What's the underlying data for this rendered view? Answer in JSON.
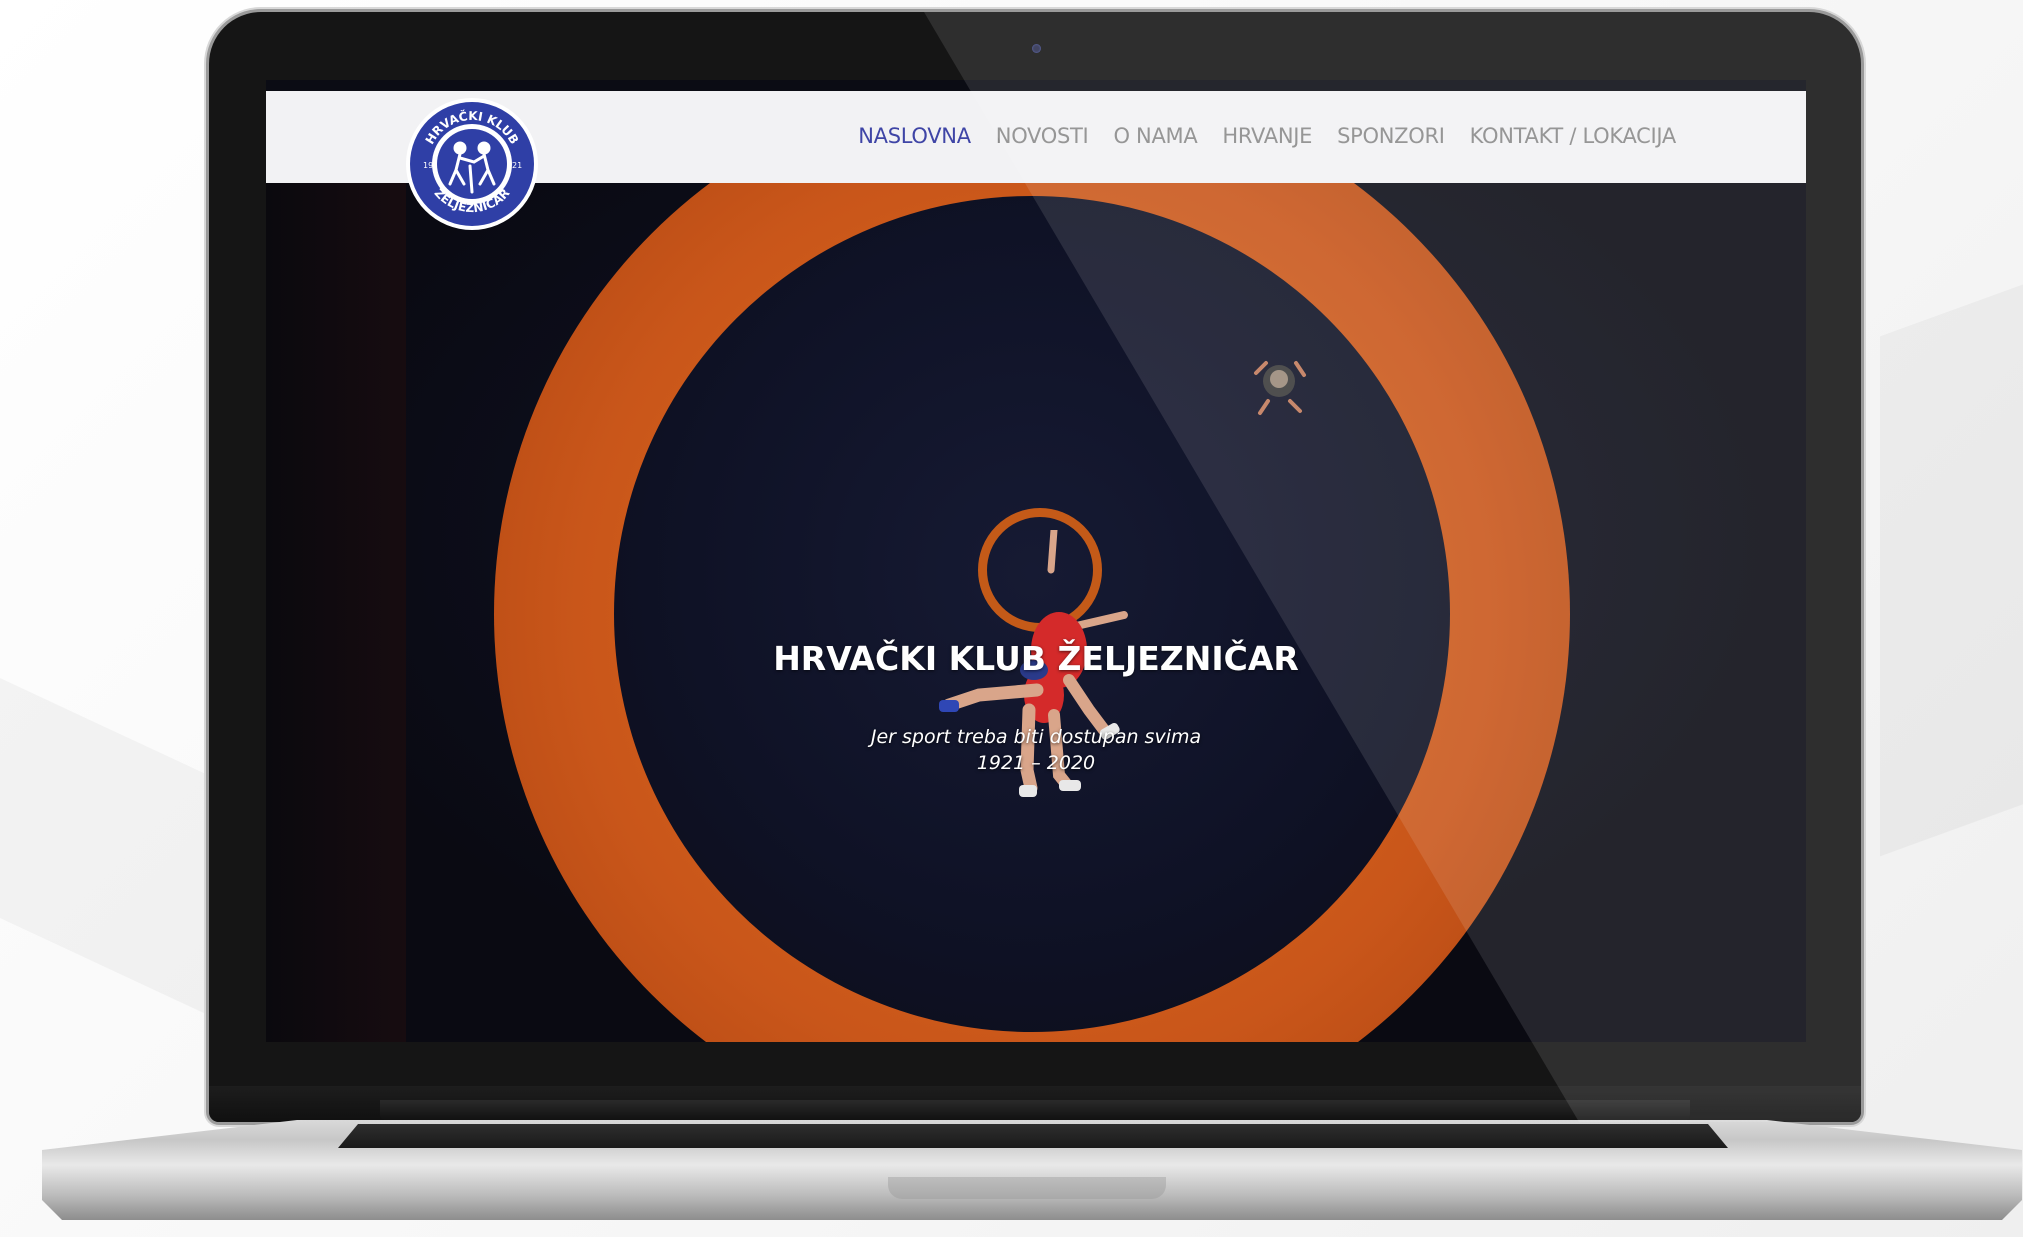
{
  "site": {
    "logo": {
      "icon": "wrestling-club-emblem",
      "text_top": "HRVAČKI KLUB",
      "text_bottom": "ŽELJEZNIČAR",
      "year_left": "19",
      "year_right": "21"
    },
    "nav": {
      "items": [
        {
          "label": "NASLOVNA",
          "active": true
        },
        {
          "label": "NOVOSTI",
          "active": false
        },
        {
          "label": "O NAMA",
          "active": false
        },
        {
          "label": "HRVANJE",
          "active": false
        },
        {
          "label": "SPONZORI",
          "active": false
        },
        {
          "label": "KONTAKT / LOKACIJA",
          "active": false
        }
      ]
    },
    "hero": {
      "title": "HRVAČKI KLUB ŽELJEZNIČAR",
      "subtitle": "Jer sport treba biti dostupan svima",
      "years": "1921 – 2020",
      "scroll_icon": "chevron-down-icon"
    }
  },
  "colors": {
    "nav_active": "#3f45a6",
    "nav_text": "#8a8a8a",
    "navbar_bg": "#f2f2f4",
    "mat_orange": "#d4601b",
    "mat_dark": "#0f1226"
  }
}
